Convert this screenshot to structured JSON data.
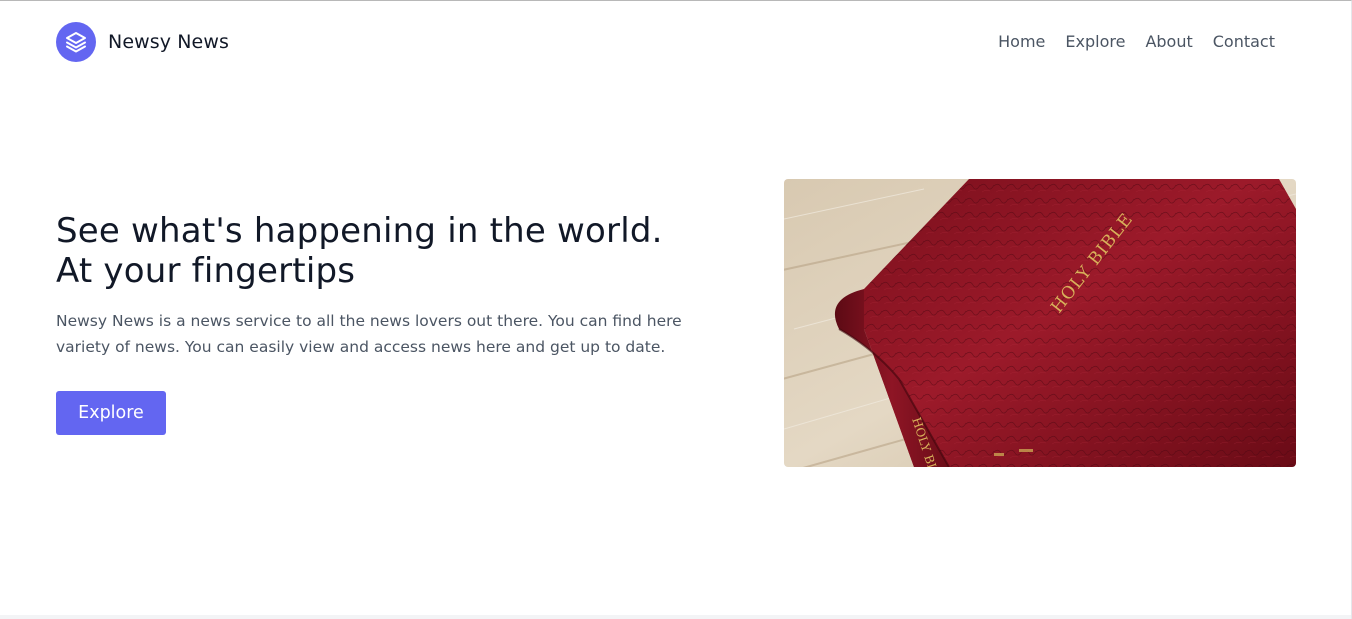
{
  "header": {
    "brand_name": "Newsy News",
    "logo_icon": "layers-icon",
    "nav": [
      {
        "label": "Home"
      },
      {
        "label": "Explore"
      },
      {
        "label": "About"
      },
      {
        "label": "Contact"
      }
    ]
  },
  "hero": {
    "title_line1": "See what's happening in the world.",
    "title_line2": "At your fingertips",
    "description": "Newsy News is a news service to all the news lovers out there. You can find here variety of news. You can easily view and access news here and get up to date.",
    "cta_label": "Explore",
    "image": {
      "subject": "red leather bible on wooden table",
      "cover_text": "HOLY BIBLE",
      "spine_text": "HOLY BIBLE"
    }
  },
  "colors": {
    "accent": "#6366f1",
    "heading": "#111827",
    "body_text": "#4b5563"
  }
}
